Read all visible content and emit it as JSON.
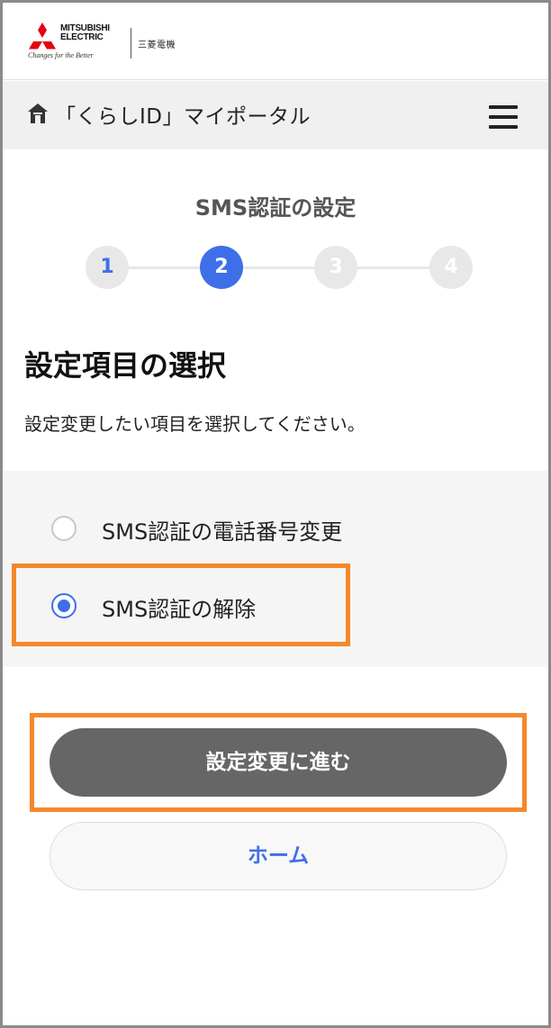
{
  "brand": {
    "logo_line1": "MITSUBISHI",
    "logo_line2": "ELECTRIC",
    "tagline": "Changes for the Better",
    "kanji": "三菱電機",
    "logo_color": "#e60012"
  },
  "header": {
    "title": "「くらしID」マイポータル",
    "home_icon": "home-icon",
    "menu_icon": "hamburger-menu-icon"
  },
  "steps": {
    "title": "SMS認証の設定",
    "current": 2,
    "items": [
      "1",
      "2",
      "3",
      "4"
    ]
  },
  "section": {
    "heading": "設定項目の選択",
    "description": "設定変更したい項目を選択してください。"
  },
  "options": [
    {
      "label": "SMS認証の電話番号変更",
      "checked": false
    },
    {
      "label": "SMS認証の解除",
      "checked": true
    }
  ],
  "buttons": {
    "primary_label": "設定変更に進む",
    "secondary_label": "ホーム"
  },
  "colors": {
    "accent": "#3f6fe8",
    "highlight": "#f5882b",
    "primary_button": "#666666"
  }
}
